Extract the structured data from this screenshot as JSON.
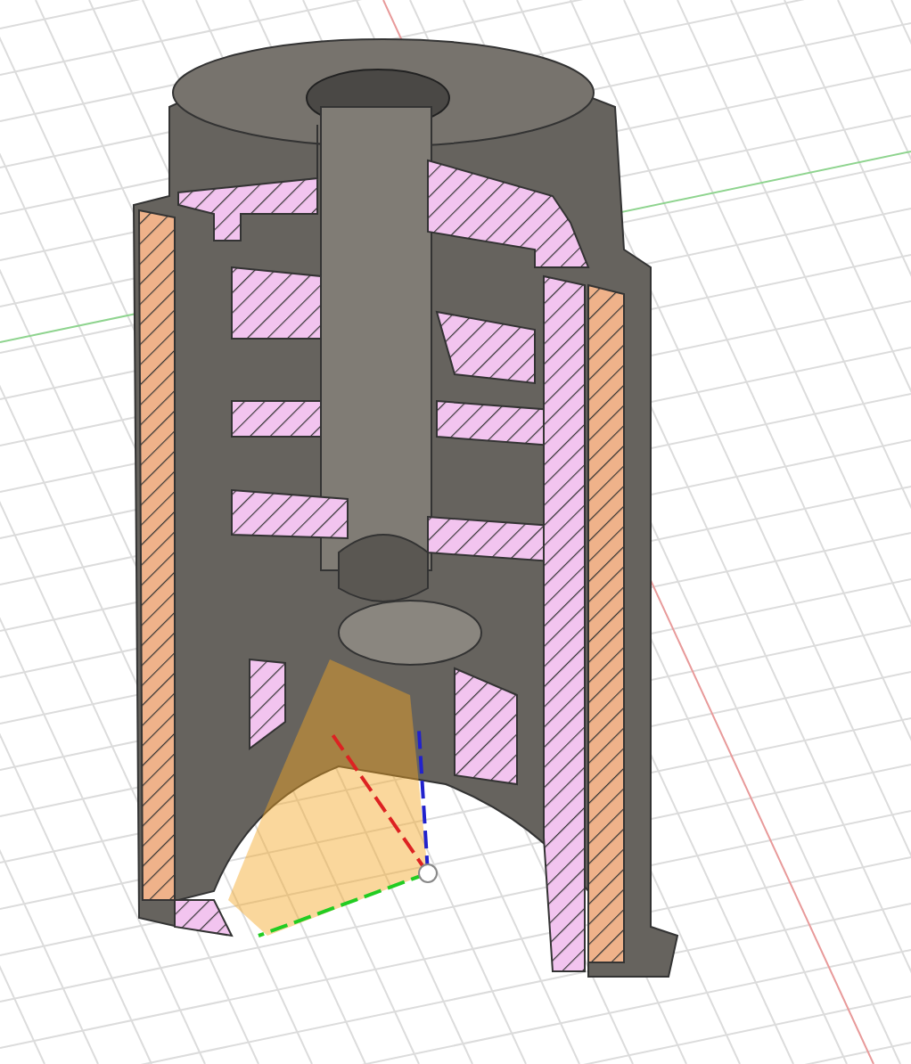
{
  "viewport": {
    "kind": "section-view",
    "grid": true
  }
}
